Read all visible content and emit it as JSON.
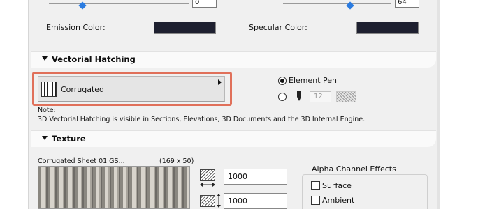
{
  "material": {
    "emission_value": "0",
    "specular_value": "64",
    "emission_label": "Emission Color:",
    "specular_label": "Specular Color:",
    "emission_color": "#1e2030",
    "specular_color": "#1e2030"
  },
  "vectorial_hatching": {
    "section_title": "Vectorial Hatching",
    "hatch_name": "Corrugated",
    "element_pen_label": "Element Pen",
    "pen_value": "12",
    "note_title": "Note:",
    "note_text": "3D Vectorial Hatching is visible in Sections, Elevations, 3D Documents and the 3D Internal Engine."
  },
  "texture": {
    "section_title": "Texture",
    "texture_name": "Corrugated Sheet 01 GS...",
    "texture_size": "(169 x 50)",
    "width_value": "1000",
    "height_value": "1000",
    "alpha_group_label": "Alpha Channel Effects",
    "surface_label": "Surface",
    "ambient_label": "Ambient"
  }
}
